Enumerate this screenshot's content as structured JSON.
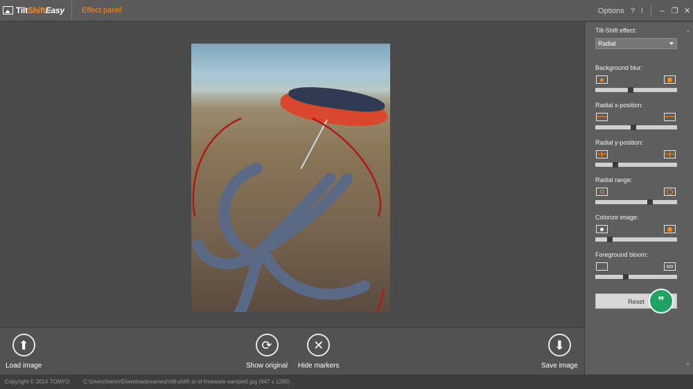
{
  "titlebar": {
    "logo_tilt": "Tilt",
    "logo_shift": "Shift",
    "logo_easy": "Easy",
    "tab": "Effect panel",
    "options": "Options",
    "help": "?",
    "info": "!",
    "min": "–",
    "restore": "❐",
    "close": "✕"
  },
  "toolbar": {
    "load": "Load image",
    "show_original": "Show original",
    "hide_markers": "Hide markers",
    "save": "Save image"
  },
  "status": {
    "copyright": "Copyright © 2014 TOMYO",
    "path": "C:\\Users\\harsh\\Downloads\\ramesh\\tilt-shift\\ st-of-freeware-sample5.jpg   (947 x 1280)"
  },
  "panel": {
    "effect_label": "Tilt-Shift effect:",
    "effect_value": "Radial",
    "controls": [
      {
        "label": "Background blur:",
        "value": 0.43
      },
      {
        "label": "Radial x-position:",
        "value": 0.46
      },
      {
        "label": "Radial y-position:",
        "value": 0.23
      },
      {
        "label": "Radial range:",
        "value": 0.68
      },
      {
        "label": "Colorize image:",
        "value": 0.15
      },
      {
        "label": "Foreground bloom:",
        "value": 0.36
      }
    ],
    "reset": "Reset",
    "hangout_glyph": "❞"
  },
  "colors": {
    "accent": "#ff8a1a",
    "marker": "#b01818"
  }
}
